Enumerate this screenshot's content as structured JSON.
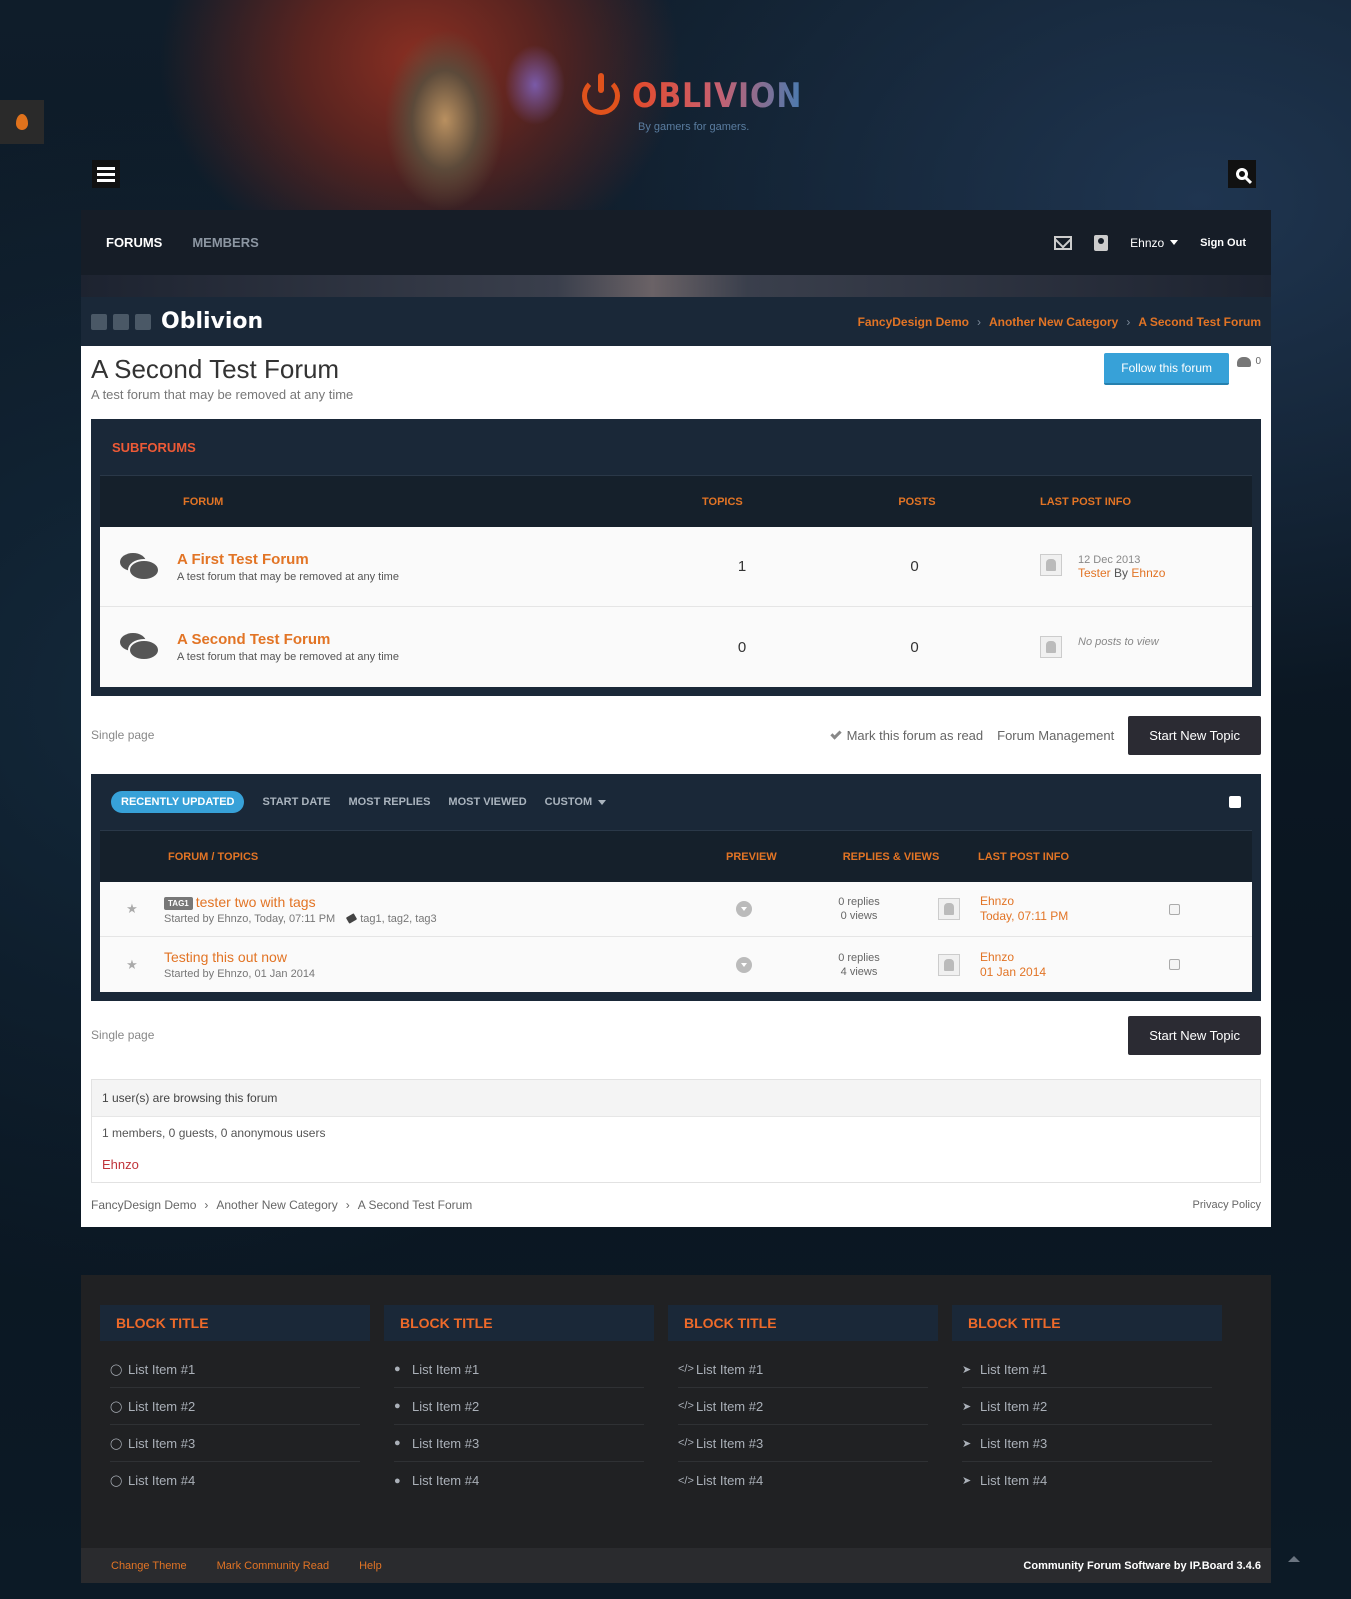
{
  "header": {
    "logo_text": "OBLIVION",
    "tagline": "By gamers for gamers."
  },
  "nav": {
    "items": [
      "FORUMS",
      "MEMBERS"
    ],
    "user": "Ehnzo",
    "sign_out": "Sign Out"
  },
  "board": {
    "name": "Oblivion",
    "breadcrumbs": [
      "FancyDesign Demo",
      "Another New Category",
      "A Second Test Forum"
    ]
  },
  "forum": {
    "title": "A Second Test Forum",
    "description": "A test forum that may be removed at any time",
    "follow_label": "Follow this forum",
    "follower_count": "0"
  },
  "subforums": {
    "title": "SUBFORUMS",
    "columns": {
      "forum": "FORUM",
      "topics": "TOPICS",
      "posts": "POSTS",
      "last": "LAST POST INFO"
    },
    "rows": [
      {
        "name": "A First Test Forum",
        "desc": "A test forum that may be removed at any time",
        "topics": "1",
        "posts": "0",
        "date": "12 Dec 2013",
        "topic": "Tester",
        "by": "By",
        "author": "Ehnzo"
      },
      {
        "name": "A Second Test Forum",
        "desc": "A test forum that may be removed at any time",
        "topics": "0",
        "posts": "0",
        "no_posts": "No posts to view"
      }
    ]
  },
  "actions": {
    "single_page": "Single page",
    "mark_read": "Mark this forum as read",
    "forum_management": "Forum Management",
    "start_new_topic": "Start New Topic"
  },
  "topics": {
    "filters": [
      "RECENTLY UPDATED",
      "START DATE",
      "MOST REPLIES",
      "MOST VIEWED",
      "CUSTOM"
    ],
    "columns": {
      "forum": "FORUM / TOPICS",
      "preview": "PREVIEW",
      "rv": "REPLIES & VIEWS",
      "last": "LAST POST INFO"
    },
    "rows": [
      {
        "tag_badge": "TAG1",
        "title": "tester two with tags",
        "meta": "Started by Ehnzo, Today, 07:11 PM",
        "tags": "tag1, tag2, tag3",
        "replies": "0 replies",
        "views": "0 views",
        "last_user": "Ehnzo",
        "last_date": "Today, 07:11 PM"
      },
      {
        "title": "Testing this out now",
        "meta": "Started by Ehnzo, 01 Jan 2014",
        "replies": "0 replies",
        "views": "4 views",
        "last_user": "Ehnzo",
        "last_date": "01 Jan 2014"
      }
    ]
  },
  "online": {
    "header": "1 user(s) are browsing this forum",
    "stats": "1 members, 0 guests, 0 anonymous users",
    "user": "Ehnzo"
  },
  "footer_crumbs": [
    "FancyDesign Demo",
    "Another New Category",
    "A Second Test Forum"
  ],
  "privacy": "Privacy Policy",
  "blocks": [
    {
      "title": "BLOCK TITLE",
      "icon": "comment-outline-icon",
      "items": [
        "List Item #1",
        "List Item #2",
        "List Item #3",
        "List Item #4"
      ]
    },
    {
      "title": "BLOCK TITLE",
      "icon": "comment-solid-icon",
      "items": [
        "List Item #1",
        "List Item #2",
        "List Item #3",
        "List Item #4"
      ]
    },
    {
      "title": "BLOCK TITLE",
      "icon": "code-icon",
      "items": [
        "List Item #1",
        "List Item #2",
        "List Item #3",
        "List Item #4"
      ]
    },
    {
      "title": "BLOCK TITLE",
      "icon": "location-arrow-icon",
      "items": [
        "List Item #1",
        "List Item #2",
        "List Item #3",
        "List Item #4"
      ]
    }
  ],
  "bottom": {
    "links": [
      "Change Theme",
      "Mark Community Read",
      "Help"
    ],
    "credit": "Community Forum Software by IP.Board 3.4.6"
  },
  "colors": {
    "accent": "#e27425",
    "follow": "#37a1d8",
    "dark": "#1a2838"
  }
}
